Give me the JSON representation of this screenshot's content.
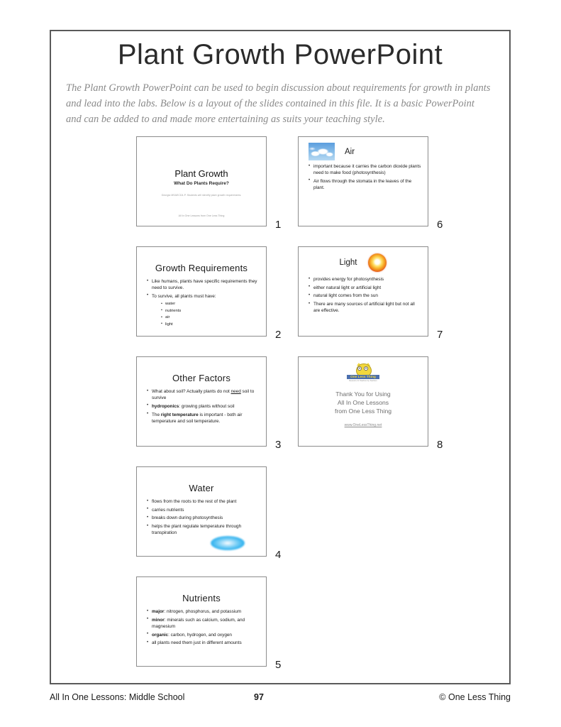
{
  "document": {
    "title": "Plant Growth PowerPoint",
    "intro": "The Plant Growth PowerPoint can be used to begin discussion about requirements for growth in plants and lead into the labs. Below is a layout of the slides contained in this file. It is a basic PowerPoint and can be added to and made more entertaining as suits your teaching style."
  },
  "slides": {
    "s1": {
      "number": "1",
      "title": "Plant Growth",
      "subtitle": "What Do Plants Require?",
      "standard": "Georgia MSAECD4-P. Students will identify plant growth requirements.",
      "footer": "All In One Lessons from One Less Thing"
    },
    "s2": {
      "number": "2",
      "title": "Growth Requirements",
      "b1": "Like humans, plants have specific requirements they need to survive.",
      "b2": "To survive, all plants must have:",
      "sub1": "water",
      "sub2": "nutrients",
      "sub3": "air",
      "sub4": "light"
    },
    "s3": {
      "number": "3",
      "title": "Other Factors",
      "b1_pre": "What about soil? Actually plants do not ",
      "b1_underline": "need",
      "b1_post": " soil to survive",
      "b2_bold": "hydroponics",
      "b2_post": ": growing plants without soil",
      "b3_pre": "The ",
      "b3_bold": "right temperature",
      "b3_post": " is important - both air temperature and soil temperature."
    },
    "s4": {
      "number": "4",
      "title": "Water",
      "b1": "flows from the roots to the rest of the plant",
      "b2": "carries nutrients",
      "b3": "breaks down during photosynthesis",
      "b4": "helps the plant regulate temperature through transpiration"
    },
    "s5": {
      "number": "5",
      "title": "Nutrients",
      "b1_bold": "major",
      "b1_post": ": nitrogen, phosphorus, and potassium",
      "b2_bold": "minor",
      "b2_post": ": minerals such as calcium, sodium, and magnesium",
      "b3_bold": "organic",
      "b3_post": ": carbon, hydrogen, and oxygen",
      "b4": "all plants need them just in different amounts"
    },
    "s6": {
      "number": "6",
      "title": "Air",
      "b1": "important because it carries the carbon dioxide plants need to make food (photosynthesis)",
      "b2": "Air flows through the stomata in the leaves of the plant."
    },
    "s7": {
      "number": "7",
      "title": "Light",
      "b1": "provides energy for photosynthesis",
      "b2": "either natural light or artificial light",
      "b3": "natural light comes from the sun",
      "b4": "There are many sources of artificial light but not all are effective."
    },
    "s8": {
      "number": "8",
      "logo_word": "One Less Thing",
      "logo_tag": "Resource for Teachers by Teachers",
      "line1": "Thank You for Using",
      "line2": "All In One Lessons",
      "line3": "from One Less Thing",
      "url": "www.OneLessThing.net"
    }
  },
  "footer": {
    "left": "All In One Lessons: Middle School",
    "page": "97",
    "right": "© One Less Thing"
  },
  "colors": {
    "border": "#5a5a5a",
    "slide_border": "#8c8c8c",
    "intro_text": "#8a8a8a",
    "sun": "#f5a623",
    "sky": "#5b9ede",
    "owl": "#f2d73c",
    "logo_bar": "#4b6fae"
  }
}
